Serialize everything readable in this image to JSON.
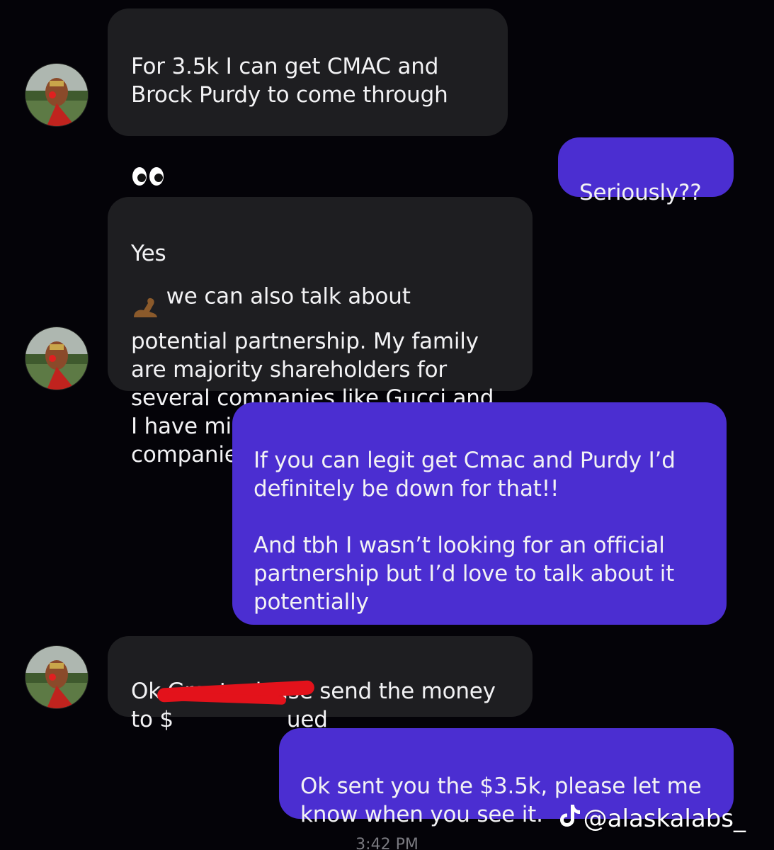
{
  "conversation": {
    "messages": [
      {
        "sender": "them",
        "text": "For 3.5k I can get CMAC and\nBrock Purdy to come through",
        "emoji": "eyes"
      },
      {
        "sender": "me",
        "text": "Seriously??"
      },
      {
        "sender": "them",
        "text_before_emoji": "Yes",
        "emoji": "flexed-biceps",
        "text_after_emoji": " we can also talk about\npotential partnership. My family\nare majority shareholders for\nseveral companies like Gucci and\nI have millions to invest in\ncompanies that I see fit"
      },
      {
        "sender": "me",
        "text": "If you can legit get Cmac and Purdy I’d\ndefinitely be down for that!!\n\nAnd tbh I wasn’t looking for an official\npartnership but  I’d love to talk about it\npotentially"
      },
      {
        "sender": "them",
        "text": "Ok Great, please send the money\nto $",
        "redacted_suffix": "ued"
      },
      {
        "sender": "me",
        "text": "Ok sent you the $3.5k, please let me\nknow when you see it."
      }
    ],
    "timestamp": "3:42 PM"
  },
  "watermark": {
    "icon": "tiktok-icon",
    "handle": "@alaskalabs_"
  },
  "colors": {
    "background": "#040308",
    "incoming_bubble": "#1e1e21",
    "outgoing_bubble": "#4b2ed1",
    "redaction": "#e3121b"
  }
}
